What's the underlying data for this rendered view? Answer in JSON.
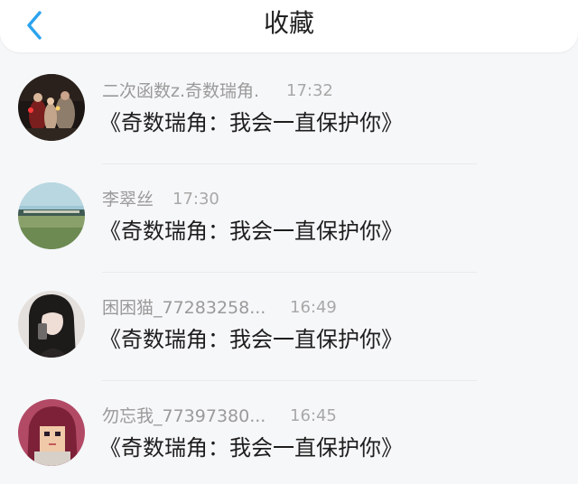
{
  "header": {
    "title": "收藏",
    "back_icon": "chevron-left-icon",
    "accent_color": "#2aa3ef"
  },
  "favorites": [
    {
      "name": "二次函数z.奇数瑞角.",
      "time": "17:32",
      "content": "《奇数瑞角：我会一直保护你》",
      "avatar_icon": "night-crowd-photo"
    },
    {
      "name": "李翠丝",
      "time": "17:30",
      "content": "《奇数瑞角：我会一直保护你》",
      "avatar_icon": "grassland-sky-photo"
    },
    {
      "name": "困困猫_77283258...",
      "time": "16:49",
      "content": "《奇数瑞角：我会一直保护你》",
      "avatar_icon": "girl-selfie-photo"
    },
    {
      "name": "勿忘我_77397380...",
      "time": "16:45",
      "content": "《奇数瑞角：我会一直保护你》",
      "avatar_icon": "pixel-girl-avatar"
    }
  ]
}
